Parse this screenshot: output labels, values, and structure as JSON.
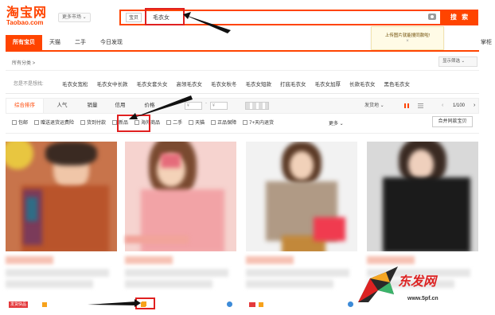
{
  "header": {
    "logo_main": "淘宝网",
    "logo_sub": "Taobao.com",
    "market": "更多市场 ⌄",
    "search_tab": "宝贝",
    "search_value": "毛衣女",
    "search_button": "搜 索",
    "tip_text": "上传图片就能搜同款啦!",
    "tip_close": "×",
    "promo_edge": "掌柜"
  },
  "tabs": [
    "所有宝贝",
    "天猫",
    "二手",
    "今日发现"
  ],
  "category": {
    "label": "所有分类 >",
    "display_filter": "显示筛选 ⌄"
  },
  "related": {
    "label": "您是不是想找:",
    "items": [
      "毛衣女宽松",
      "毛衣女中长款",
      "毛衣女套头女",
      "高领毛衣女",
      "毛衣女秋冬",
      "毛衣女短款",
      "打底毛衣女",
      "毛衣女加厚",
      "长款毛衣女",
      "黑色毛衣女"
    ]
  },
  "sort": {
    "items": [
      "综合排序",
      "人气",
      "销量",
      "信用",
      "价格"
    ],
    "price_from": "¥",
    "price_to": "¥",
    "price_dash": "-",
    "ship_to": "发货地 ⌄",
    "page": "1/100",
    "prev": "‹",
    "next": "›"
  },
  "filters": {
    "items": [
      "包邮",
      "赠送退货运费险",
      "货到付款",
      "新品",
      "海外商品",
      "二手",
      "天猫",
      "正品保障",
      "7+天内退货"
    ],
    "more": "更多 ⌄",
    "compare": "合并同款宝贝"
  },
  "cards": [
    {
      "tag": "发货快品"
    },
    {
      "tag": ""
    },
    {
      "tag": ""
    },
    {
      "tag": ""
    }
  ],
  "watermark": {
    "name": "东发网",
    "url": "www.5pf.cn"
  },
  "colors": {
    "brand": "#ff4400",
    "highlight": "#e02020"
  }
}
